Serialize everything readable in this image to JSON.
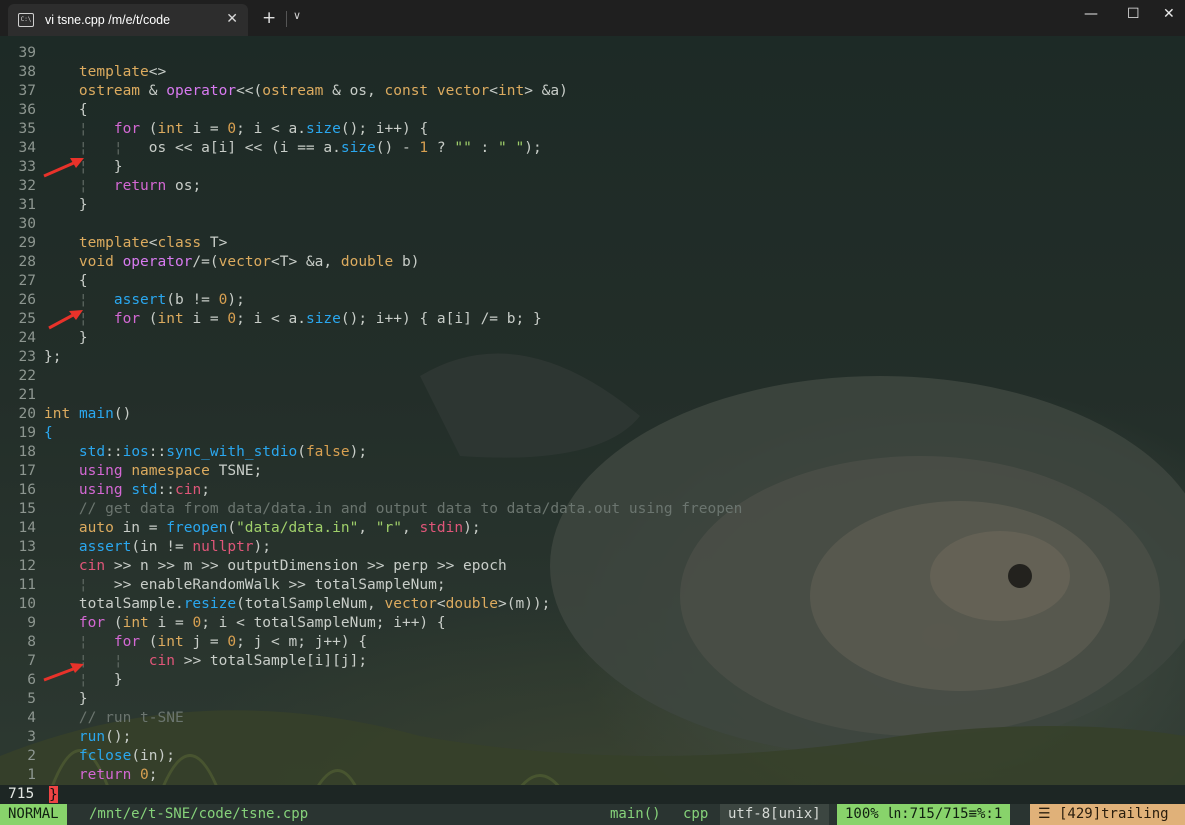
{
  "window": {
    "tab_title": "vi tsne.cpp  /m/e/t/code",
    "tab_icon": "terminal-icon",
    "close_tab": "✕",
    "new_tab": "+",
    "dropdown": "⌄",
    "minimize": "—",
    "maximize": "☐",
    "close": "✕"
  },
  "editor": {
    "lines": [
      {
        "n": "39",
        "code": ""
      },
      {
        "n": "38",
        "code": "    template<>"
      },
      {
        "n": "37",
        "code": "    ostream & operator<<(ostream & os, const vector<int> &a)"
      },
      {
        "n": "36",
        "code": "    {"
      },
      {
        "n": "35",
        "code": "    ¦   for (int i = 0; i < a.size(); i++) {"
      },
      {
        "n": "34",
        "code": "    ¦   ¦   os << a[i] << (i == a.size() - 1 ? \"\" : \" \");"
      },
      {
        "n": "33",
        "code": "    ¦   }"
      },
      {
        "n": "32",
        "code": "    ¦   return os;"
      },
      {
        "n": "31",
        "code": "    }"
      },
      {
        "n": "30",
        "code": ""
      },
      {
        "n": "29",
        "code": "    template<class T>"
      },
      {
        "n": "28",
        "code": "    void operator/=(vector<T> &a, double b)"
      },
      {
        "n": "27",
        "code": "    {"
      },
      {
        "n": "26",
        "code": "    ¦   assert(b != 0);"
      },
      {
        "n": "25",
        "code": "    ¦   for (int i = 0; i < a.size(); i++) { a[i] /= b; }"
      },
      {
        "n": "24",
        "code": "    }"
      },
      {
        "n": "23",
        "code": "};"
      },
      {
        "n": "22",
        "code": ""
      },
      {
        "n": "21",
        "code": ""
      },
      {
        "n": "20",
        "code": "int main()"
      },
      {
        "n": "19",
        "code": "{"
      },
      {
        "n": "18",
        "code": "    std::ios::sync_with_stdio(false);"
      },
      {
        "n": "17",
        "code": "    using namespace TSNE;"
      },
      {
        "n": "16",
        "code": "    using std::cin;"
      },
      {
        "n": "15",
        "code": "    // get data from data/data.in and output data to data/data.out using freopen"
      },
      {
        "n": "14",
        "code": "    auto in = freopen(\"data/data.in\", \"r\", stdin);"
      },
      {
        "n": "13",
        "code": "    assert(in != nullptr);"
      },
      {
        "n": "12",
        "code": "    cin >> n >> m >> outputDimension >> perp >> epoch"
      },
      {
        "n": "11",
        "code": "    ¦   >> enableRandomWalk >> totalSampleNum;"
      },
      {
        "n": "10",
        "code": "    totalSample.resize(totalSampleNum, vector<double>(m));"
      },
      {
        "n": "9",
        "code": "    for (int i = 0; i < totalSampleNum; i++) {"
      },
      {
        "n": "8",
        "code": "    ¦   for (int j = 0; j < m; j++) {"
      },
      {
        "n": "7",
        "code": "    ¦   ¦   cin >> totalSample[i][j];"
      },
      {
        "n": "6",
        "code": "    ¦   }"
      },
      {
        "n": "5",
        "code": "    }"
      },
      {
        "n": "4",
        "code": "    // run t-SNE"
      },
      {
        "n": "3",
        "code": "    run();"
      },
      {
        "n": "2",
        "code": "    fclose(in);"
      },
      {
        "n": "1",
        "code": "    return 0;"
      }
    ]
  },
  "cmdline": {
    "line_number": "715",
    "cursor_char": "}"
  },
  "statusbar": {
    "mode": "NORMAL",
    "path": "/mnt/e/t-SNE/code/tsne.cpp",
    "function": "main()",
    "filetype": "cpp",
    "encoding": "utf-8[unix]",
    "position": "100%  ㏑:715/715≡%:1",
    "warning": "☰ [429]trailing"
  },
  "colors": {
    "mode_bg": "#88d36b",
    "warning_bg": "#e0b179",
    "arrow": "#e8322a"
  }
}
